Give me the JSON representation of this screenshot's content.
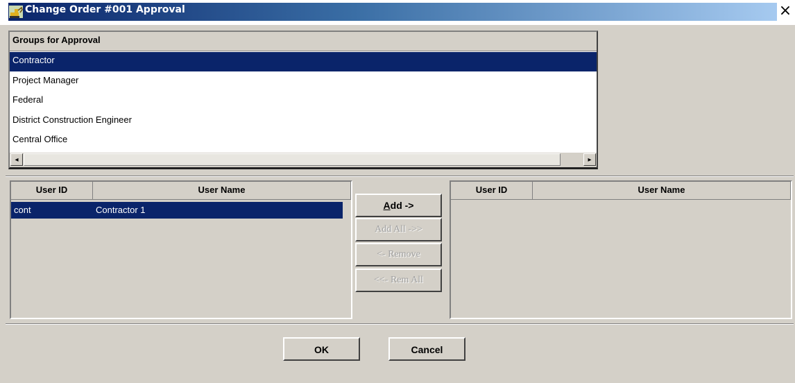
{
  "window": {
    "title": "Change Order #001 Approval",
    "close_glyph": "×"
  },
  "groups": {
    "header": "Groups for Approval",
    "items": [
      "Contractor",
      "Project Manager",
      "Federal",
      "District Construction Engineer",
      "Central Office"
    ],
    "selected_index": 0,
    "scroll_left_glyph": "◂",
    "scroll_right_glyph": "▸"
  },
  "available_users": {
    "columns": [
      "User ID",
      "User Name"
    ],
    "rows": [
      {
        "id": "cont",
        "name": "Contractor 1"
      }
    ]
  },
  "selected_users": {
    "columns": [
      "User ID",
      "User Name"
    ],
    "rows": []
  },
  "transfer_buttons": {
    "add_underline": "A",
    "add_rest": "dd ->",
    "add_all": "Add All ->>",
    "remove": "<- Remove",
    "remove_all": "<<- Rem All"
  },
  "dialog_buttons": {
    "ok": "OK",
    "cancel": "Cancel"
  },
  "colors": {
    "selection": "#0a246a",
    "face": "#d4d0c8",
    "title_start": "#0a246a",
    "title_end": "#a6caf0"
  },
  "icons": {
    "app": "excavator-icon",
    "close": "close-icon"
  }
}
